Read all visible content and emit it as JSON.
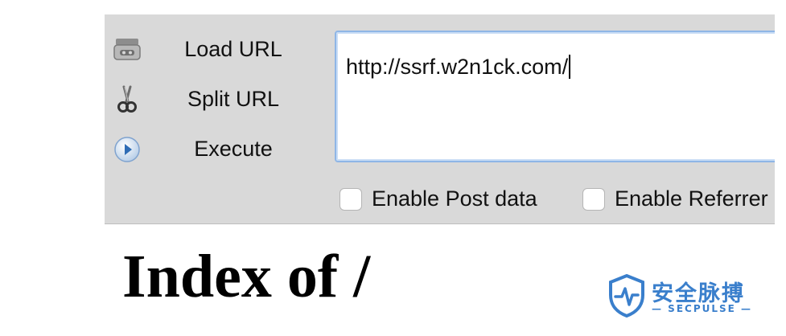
{
  "toolbar": {
    "actions": [
      {
        "label": "Load URL",
        "icon": "load-url-icon"
      },
      {
        "label": "Split URL",
        "icon": "scissors-icon"
      },
      {
        "label": "Execute",
        "icon": "play-icon"
      }
    ],
    "url_value": "http://ssrf.w2n1ck.com/",
    "checkboxes": [
      {
        "label": "Enable Post data",
        "checked": false
      },
      {
        "label": "Enable Referrer",
        "checked": false
      }
    ]
  },
  "content": {
    "heading": "Index of /"
  },
  "watermark": {
    "chinese": "安全脉搏",
    "english": "— SECPULSE —"
  },
  "colors": {
    "toolbar_bg": "#d9d9d9",
    "input_focus_border": "#8fb6e6",
    "watermark_blue": "#3a7fcc"
  }
}
